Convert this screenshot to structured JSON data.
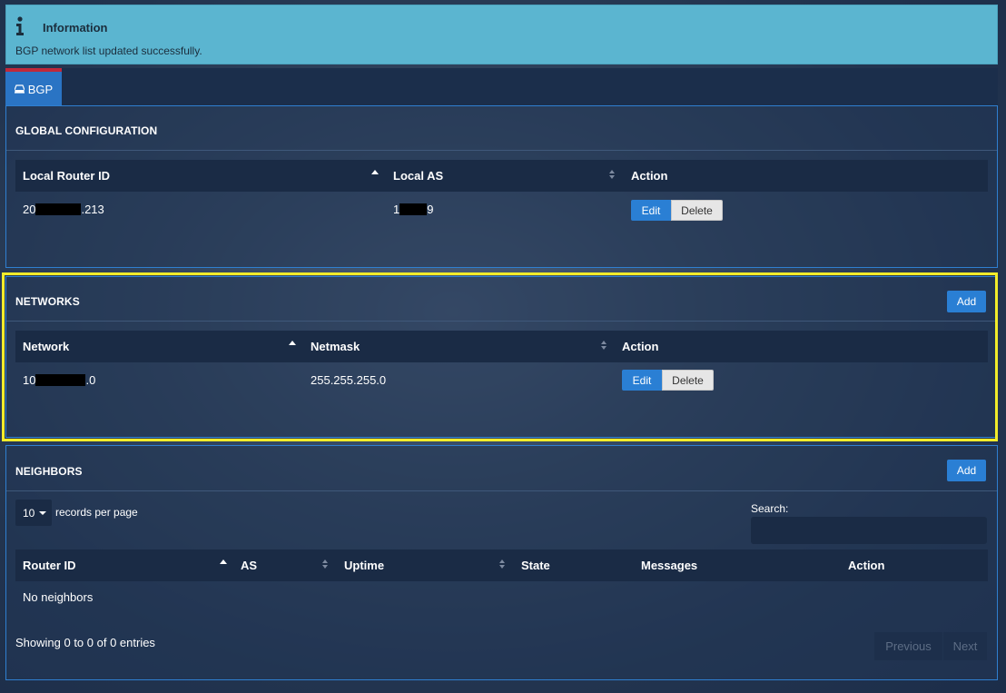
{
  "info": {
    "title": "Information",
    "message": "BGP network list updated successfully."
  },
  "tabs": [
    {
      "label": "BGP",
      "icon": "router-icon",
      "active": true
    }
  ],
  "global": {
    "title": "GLOBAL CONFIGURATION",
    "columns": [
      "Local Router ID",
      "Local AS",
      "Action"
    ],
    "row": {
      "router_id_prefix": "20",
      "router_id_suffix": ".213",
      "local_as_prefix": "1",
      "local_as_suffix": "9"
    },
    "edit_label": "Edit",
    "delete_label": "Delete"
  },
  "networks": {
    "title": "NETWORKS",
    "add_label": "Add",
    "columns": [
      "Network",
      "Netmask",
      "Action"
    ],
    "row": {
      "network_prefix": "10",
      "network_suffix": ".0",
      "netmask": "255.255.255.0"
    },
    "edit_label": "Edit",
    "delete_label": "Delete"
  },
  "neighbors": {
    "title": "NEIGHBORS",
    "add_label": "Add",
    "page_length": "10",
    "records_per_page": "records per page",
    "search_label": "Search:",
    "search_value": "",
    "columns": [
      "Router ID",
      "AS",
      "Uptime",
      "State",
      "Messages",
      "Action"
    ],
    "empty_text": "No neighbors",
    "info_text": "Showing 0 to 0 of 0 entries",
    "previous_label": "Previous",
    "next_label": "Next"
  },
  "colors": {
    "info_bg": "#5bb5d0",
    "accent": "#2a7fd4",
    "tab_top": "#c0283a",
    "highlight": "#f2ec2a"
  }
}
